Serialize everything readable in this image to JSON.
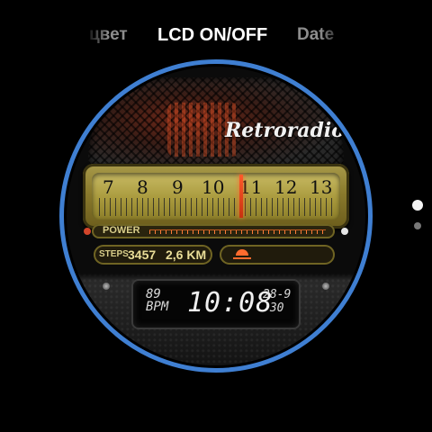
{
  "picker": {
    "left": "цвет",
    "selected": "LCD ON/OFF",
    "right": "Date"
  },
  "page_indicator": {
    "count": 2,
    "active_index": 0
  },
  "face": {
    "brand": "Retroradio",
    "dial_numbers": [
      "7",
      "8",
      "9",
      "10",
      "11",
      "12",
      "13"
    ],
    "power_label": "POWER",
    "steps_label": "STEPS",
    "steps_value": "3457",
    "distance": "2,6 KM",
    "bpm_value": "89",
    "bpm_label": "BPM",
    "time": "10:08",
    "date_day_month": "28-9",
    "date_extra": "30"
  },
  "colors": {
    "ring": "#3f7fd2",
    "tuner": "#a89a4a",
    "needle": "#ff5a2a",
    "lcd_text": "#f0f0f0"
  },
  "icons": [
    "sunset-icon",
    "screw-icon"
  ]
}
